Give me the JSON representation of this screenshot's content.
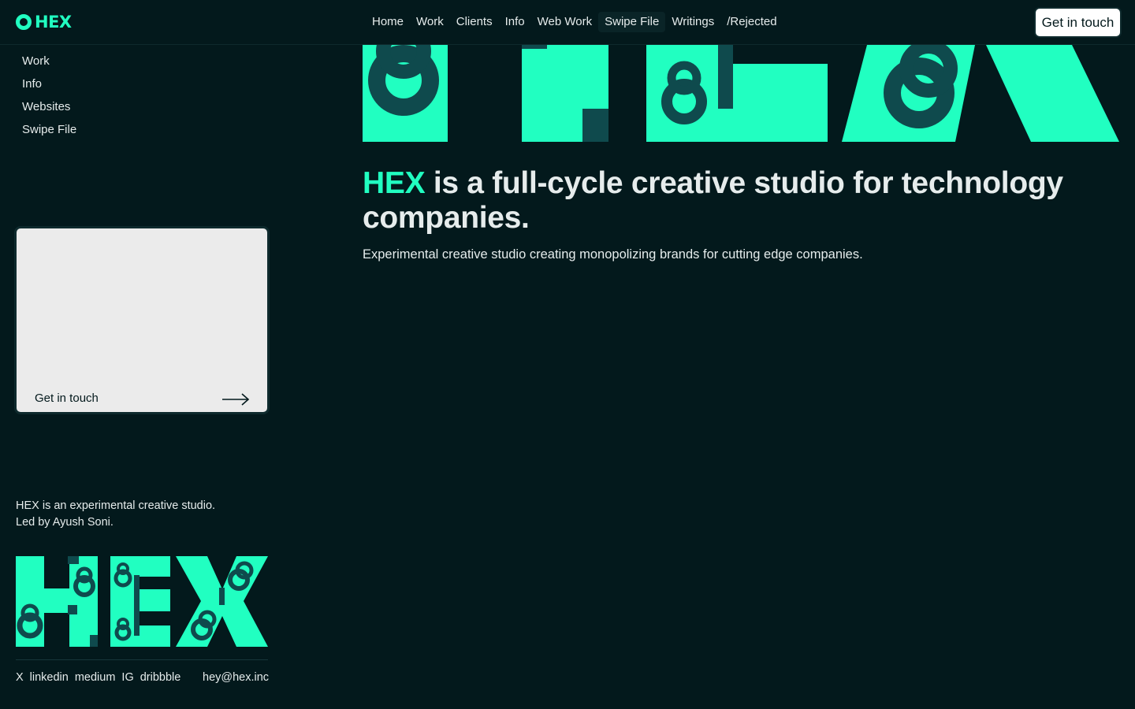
{
  "brand": {
    "name": "HEX",
    "accent": "#21ffc1",
    "dark_teal": "#0f4a4d",
    "background": "#03191c"
  },
  "nav": {
    "items": [
      "Home",
      "Work",
      "Clients",
      "Info",
      "Web Work",
      "Swipe File",
      "Writings",
      "/Rejected"
    ],
    "active": "Swipe File",
    "cta": "Get in touch"
  },
  "sidebar": {
    "links": [
      "Work",
      "Info",
      "Websites",
      "Swipe File"
    ],
    "card": {
      "label": "Get in touch",
      "icon": "arrow-right-icon"
    },
    "about": [
      "HEX is an experimental creative studio.",
      "Led by Ayush Soni."
    ],
    "social": [
      "X",
      "linkedin",
      "medium",
      "IG",
      "dribbble"
    ],
    "email": "hey@hex.inc"
  },
  "hero": {
    "headline_brand": "HEX",
    "headline_rest": " is a full-cycle creative studio for technology companies.",
    "subline": "Experimental creative studio creating monopolizing brands for cutting edge companies."
  }
}
